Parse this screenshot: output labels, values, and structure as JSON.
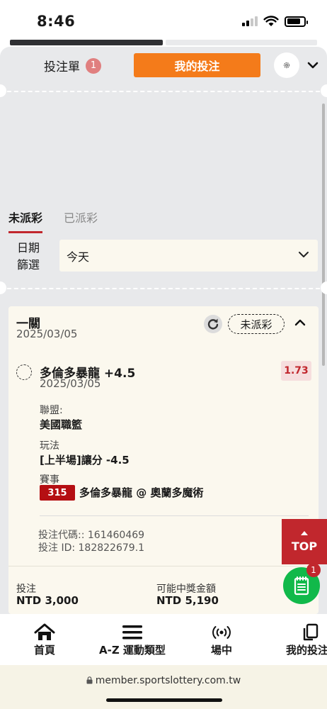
{
  "status_bar": {
    "time": "8:46"
  },
  "header": {
    "bet_slip_label": "投注單",
    "bet_slip_count": "1",
    "my_bets_button": "我的投注"
  },
  "tabs": [
    {
      "label": "未派彩",
      "active": true
    },
    {
      "label": "已派彩",
      "active": false
    }
  ],
  "date_filter": {
    "label_line1": "日期",
    "label_line2": "篩選",
    "selected": "今天"
  },
  "bet": {
    "type": "一關",
    "date": "2025/03/05",
    "status": "未派彩",
    "pick": {
      "name": "多倫多暴龍 +4.5",
      "date": "2025/03/05",
      "odds": "1.73"
    },
    "league_label": "聯盟:",
    "league_value": "美國職籃",
    "market_label": "玩法",
    "market_value": "[上半場]讓分 -4.5",
    "event_label": "賽事",
    "event_id": "315",
    "event_name": "多倫多暴龍 @ 奧蘭多魔術",
    "bet_code": "投注代碼:: 161460469",
    "bet_id": "投注 ID: 182822679.1",
    "stake_label": "投注",
    "stake_value": "NTD 3,000",
    "payout_label": "可能中獎金額",
    "payout_value": "NTD 5,190"
  },
  "floating": {
    "top_label": "TOP",
    "slip_count": "1"
  },
  "bottom_nav": [
    {
      "label": "首頁",
      "icon": "home-icon"
    },
    {
      "label": "A-Z 運動類型",
      "icon": "menu-icon"
    },
    {
      "label": "場中",
      "icon": "live-icon"
    },
    {
      "label": "我的投注",
      "icon": "copy-icon"
    }
  ],
  "browser": {
    "url": "member.sportslottery.com.tw"
  },
  "colors": {
    "accent_orange": "#f47b1a",
    "brand_red": "#c1272d",
    "float_green": "#11b94a",
    "panel_bg": "#e8e9eb",
    "card_bg": "#fbf8ee"
  }
}
